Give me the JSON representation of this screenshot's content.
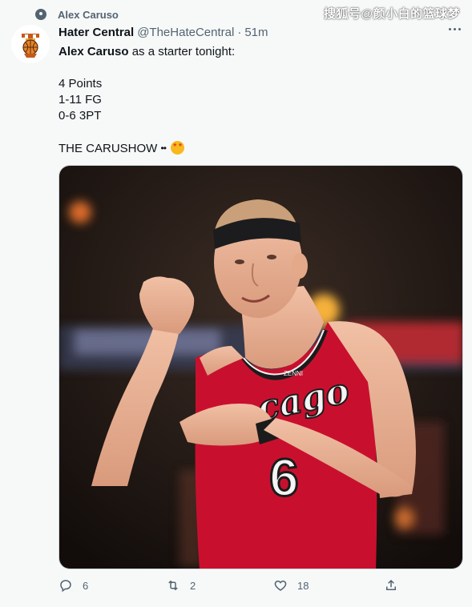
{
  "topic": {
    "label": "Alex Caruso"
  },
  "watermark": "搜狐号@颜小白的篮球梦",
  "tweet": {
    "display_name": "Hater Central",
    "handle": "@TheHateCentral",
    "separator": "·",
    "time": "51m",
    "text_bold": "Alex Caruso",
    "text_rest": " as a starter tonight:",
    "stats": [
      "4 Points",
      "1-11 FG",
      "0-6 3PT"
    ],
    "closing": "THE CARUSHOW",
    "eyes": "••",
    "image": {
      "jersey_text": "cago",
      "jersey_number": "6",
      "jersey_brand": "ZENNI"
    }
  },
  "actions": {
    "replies": "6",
    "retweets": "2",
    "likes": "18"
  },
  "colors": {
    "text": "#0f1419",
    "muted": "#536471",
    "background": "#f7f9f9",
    "jersey_red": "#c8102e"
  },
  "icons": [
    "topic-icon",
    "more-icon",
    "reply-icon",
    "retweet-icon",
    "like-icon",
    "share-icon",
    "star-struck-emoji"
  ]
}
